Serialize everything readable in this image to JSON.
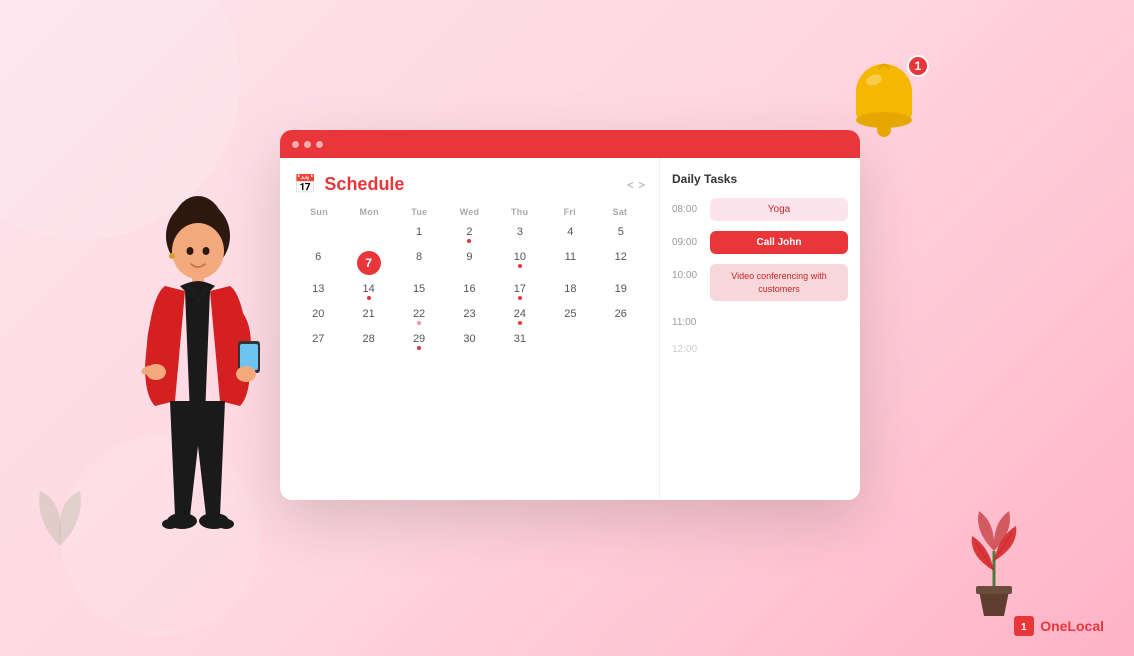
{
  "app": {
    "title": "Schedule",
    "brand": "OneLocal"
  },
  "browser": {
    "dots": [
      "dot1",
      "dot2",
      "dot3"
    ]
  },
  "calendar": {
    "title": "Schedule",
    "nav_prev": "<",
    "nav_next": ">",
    "weekdays": [
      "Sun",
      "Mon",
      "Tue",
      "Wed",
      "Thu",
      "Fri",
      "Sat"
    ],
    "days": [
      {
        "num": "",
        "dot": false,
        "empty": true
      },
      {
        "num": "",
        "dot": false,
        "empty": true
      },
      {
        "num": "1",
        "dot": false
      },
      {
        "num": "2",
        "dot": true,
        "dot_color": "red"
      },
      {
        "num": "3",
        "dot": false
      },
      {
        "num": "4",
        "dot": false
      },
      {
        "num": "5",
        "dot": false
      },
      {
        "num": "6",
        "dot": false
      },
      {
        "num": "7",
        "dot": false,
        "today": true
      },
      {
        "num": "8",
        "dot": false
      },
      {
        "num": "9",
        "dot": false
      },
      {
        "num": "10",
        "dot": true,
        "dot_color": "red"
      },
      {
        "num": "11",
        "dot": false
      },
      {
        "num": "12",
        "dot": false
      },
      {
        "num": "13",
        "dot": false
      },
      {
        "num": "14",
        "dot": true,
        "dot_color": "red"
      },
      {
        "num": "15",
        "dot": false
      },
      {
        "num": "16",
        "dot": false
      },
      {
        "num": "17",
        "dot": true,
        "dot_color": "red"
      },
      {
        "num": "18",
        "dot": false
      },
      {
        "num": "19",
        "dot": false
      },
      {
        "num": "20",
        "dot": false
      },
      {
        "num": "21",
        "dot": false
      },
      {
        "num": "22",
        "dot": true,
        "dot_color": "pink"
      },
      {
        "num": "23",
        "dot": false
      },
      {
        "num": "24",
        "dot": true,
        "dot_color": "red"
      },
      {
        "num": "25",
        "dot": false
      },
      {
        "num": "26",
        "dot": false
      },
      {
        "num": "27",
        "dot": false
      },
      {
        "num": "28",
        "dot": false
      },
      {
        "num": "29",
        "dot": true,
        "dot_color": "red"
      },
      {
        "num": "30",
        "dot": false
      },
      {
        "num": "31",
        "dot": false
      }
    ]
  },
  "daily_tasks": {
    "title": "Daily Tasks",
    "items": [
      {
        "time": "08:00",
        "label": "Yoga",
        "style": "yoga"
      },
      {
        "time": "09:00",
        "label": "Call John",
        "style": "call-john"
      },
      {
        "time": "10:00",
        "label": "Video conferencing with customers",
        "style": "video-conf"
      },
      {
        "time": "11:00",
        "label": "",
        "style": "empty"
      },
      {
        "time": "12:00",
        "label": "",
        "style": "empty"
      }
    ]
  },
  "notification": {
    "badge_count": "1"
  },
  "logo": {
    "text": "OneLocal",
    "icon": "1"
  }
}
